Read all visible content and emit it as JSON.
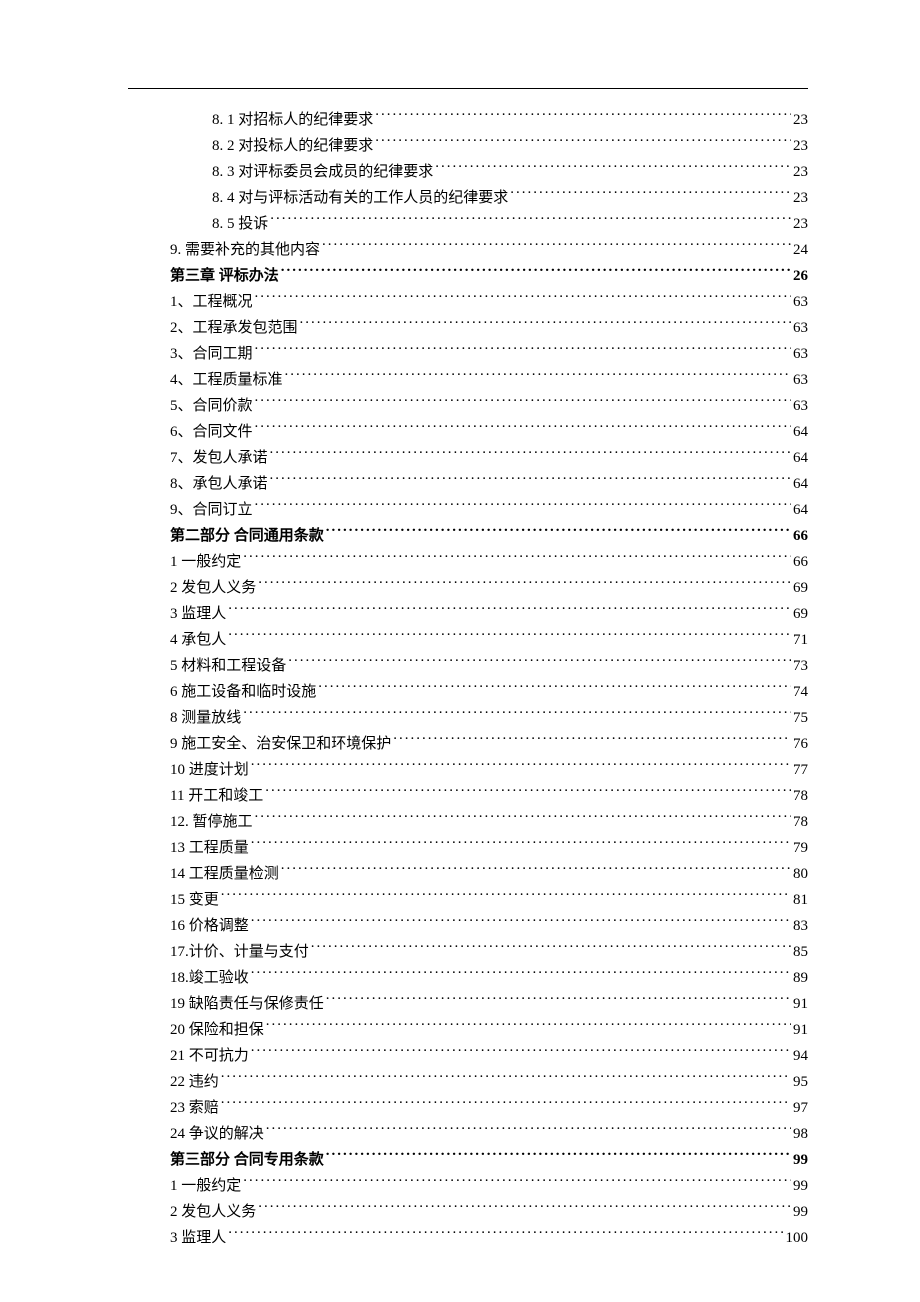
{
  "toc": [
    {
      "label": "8. 1 对招标人的纪律要求",
      "page": "23",
      "indent": 2,
      "bold": false
    },
    {
      "label": "8. 2 对投标人的纪律要求",
      "page": "23",
      "indent": 2,
      "bold": false
    },
    {
      "label": "8. 3 对评标委员会成员的纪律要求",
      "page": "23",
      "indent": 2,
      "bold": false
    },
    {
      "label": "8. 4 对与评标活动有关的工作人员的纪律要求",
      "page": "23",
      "indent": 2,
      "bold": false
    },
    {
      "label": "8. 5 投诉",
      "page": "23",
      "indent": 2,
      "bold": false
    },
    {
      "label": "9. 需要补充的其他内容",
      "page": "24",
      "indent": 1,
      "bold": false
    },
    {
      "label": "第三章    评标办法",
      "page": "26",
      "indent": 0,
      "bold": true
    },
    {
      "label": "1、工程概况",
      "page": "63",
      "indent": 1,
      "bold": false
    },
    {
      "label": "2、工程承发包范围",
      "page": "63",
      "indent": 1,
      "bold": false
    },
    {
      "label": "3、合同工期",
      "page": "63",
      "indent": 1,
      "bold": false
    },
    {
      "label": "4、工程质量标准",
      "page": "63",
      "indent": 1,
      "bold": false
    },
    {
      "label": "5、合同价款",
      "page": "63",
      "indent": 1,
      "bold": false
    },
    {
      "label": "6、合同文件",
      "page": "64",
      "indent": 1,
      "bold": false
    },
    {
      "label": "7、发包人承诺",
      "page": "64",
      "indent": 1,
      "bold": false
    },
    {
      "label": "8、承包人承诺",
      "page": "64",
      "indent": 1,
      "bold": false
    },
    {
      "label": "9、合同订立",
      "page": "64",
      "indent": 1,
      "bold": false
    },
    {
      "label": "第二部分    合同通用条款",
      "page": "66",
      "indent": 0,
      "bold": true
    },
    {
      "label": "1 一般约定",
      "page": "66",
      "indent": 1,
      "bold": false
    },
    {
      "label": "2 发包人义务",
      "page": "69",
      "indent": 1,
      "bold": false
    },
    {
      "label": "3 监理人",
      "page": "69",
      "indent": 1,
      "bold": false
    },
    {
      "label": "4 承包人",
      "page": "71",
      "indent": 1,
      "bold": false
    },
    {
      "label": "5 材料和工程设备",
      "page": "73",
      "indent": 1,
      "bold": false
    },
    {
      "label": "6 施工设备和临时设施",
      "page": "74",
      "indent": 1,
      "bold": false
    },
    {
      "label": "8 测量放线",
      "page": "75",
      "indent": 1,
      "bold": false
    },
    {
      "label": "9 施工安全、治安保卫和环境保护",
      "page": "76",
      "indent": 1,
      "bold": false
    },
    {
      "label": "10 进度计划",
      "page": "77",
      "indent": 1,
      "bold": false
    },
    {
      "label": "11 开工和竣工",
      "page": "78",
      "indent": 1,
      "bold": false
    },
    {
      "label": "12.  暂停施工",
      "page": "78",
      "indent": 1,
      "bold": false
    },
    {
      "label": "13 工程质量",
      "page": "79",
      "indent": 1,
      "bold": false
    },
    {
      "label": "14 工程质量检测",
      "page": "80",
      "indent": 1,
      "bold": false
    },
    {
      "label": "15 变更",
      "page": "81",
      "indent": 1,
      "bold": false
    },
    {
      "label": "16 价格调整",
      "page": "83",
      "indent": 1,
      "bold": false
    },
    {
      "label": "17.计价、计量与支付",
      "page": "85",
      "indent": 1,
      "bold": false
    },
    {
      "label": "18.竣工验收",
      "page": "89",
      "indent": 1,
      "bold": false
    },
    {
      "label": "19 缺陷责任与保修责任",
      "page": "91",
      "indent": 1,
      "bold": false
    },
    {
      "label": "20 保险和担保",
      "page": "91",
      "indent": 1,
      "bold": false
    },
    {
      "label": "21 不可抗力",
      "page": "94",
      "indent": 1,
      "bold": false
    },
    {
      "label": "22 违约",
      "page": "95",
      "indent": 1,
      "bold": false
    },
    {
      "label": "23 索赔",
      "page": "97",
      "indent": 1,
      "bold": false
    },
    {
      "label": "24 争议的解决",
      "page": "98",
      "indent": 1,
      "bold": false
    },
    {
      "label": "第三部分    合同专用条款",
      "page": "99",
      "indent": 0,
      "bold": true
    },
    {
      "label": "1 一般约定",
      "page": "99",
      "indent": 1,
      "bold": false
    },
    {
      "label": "2 发包人义务",
      "page": "99",
      "indent": 1,
      "bold": false
    },
    {
      "label": "3 监理人",
      "page": "100",
      "indent": 1,
      "bold": false
    }
  ]
}
